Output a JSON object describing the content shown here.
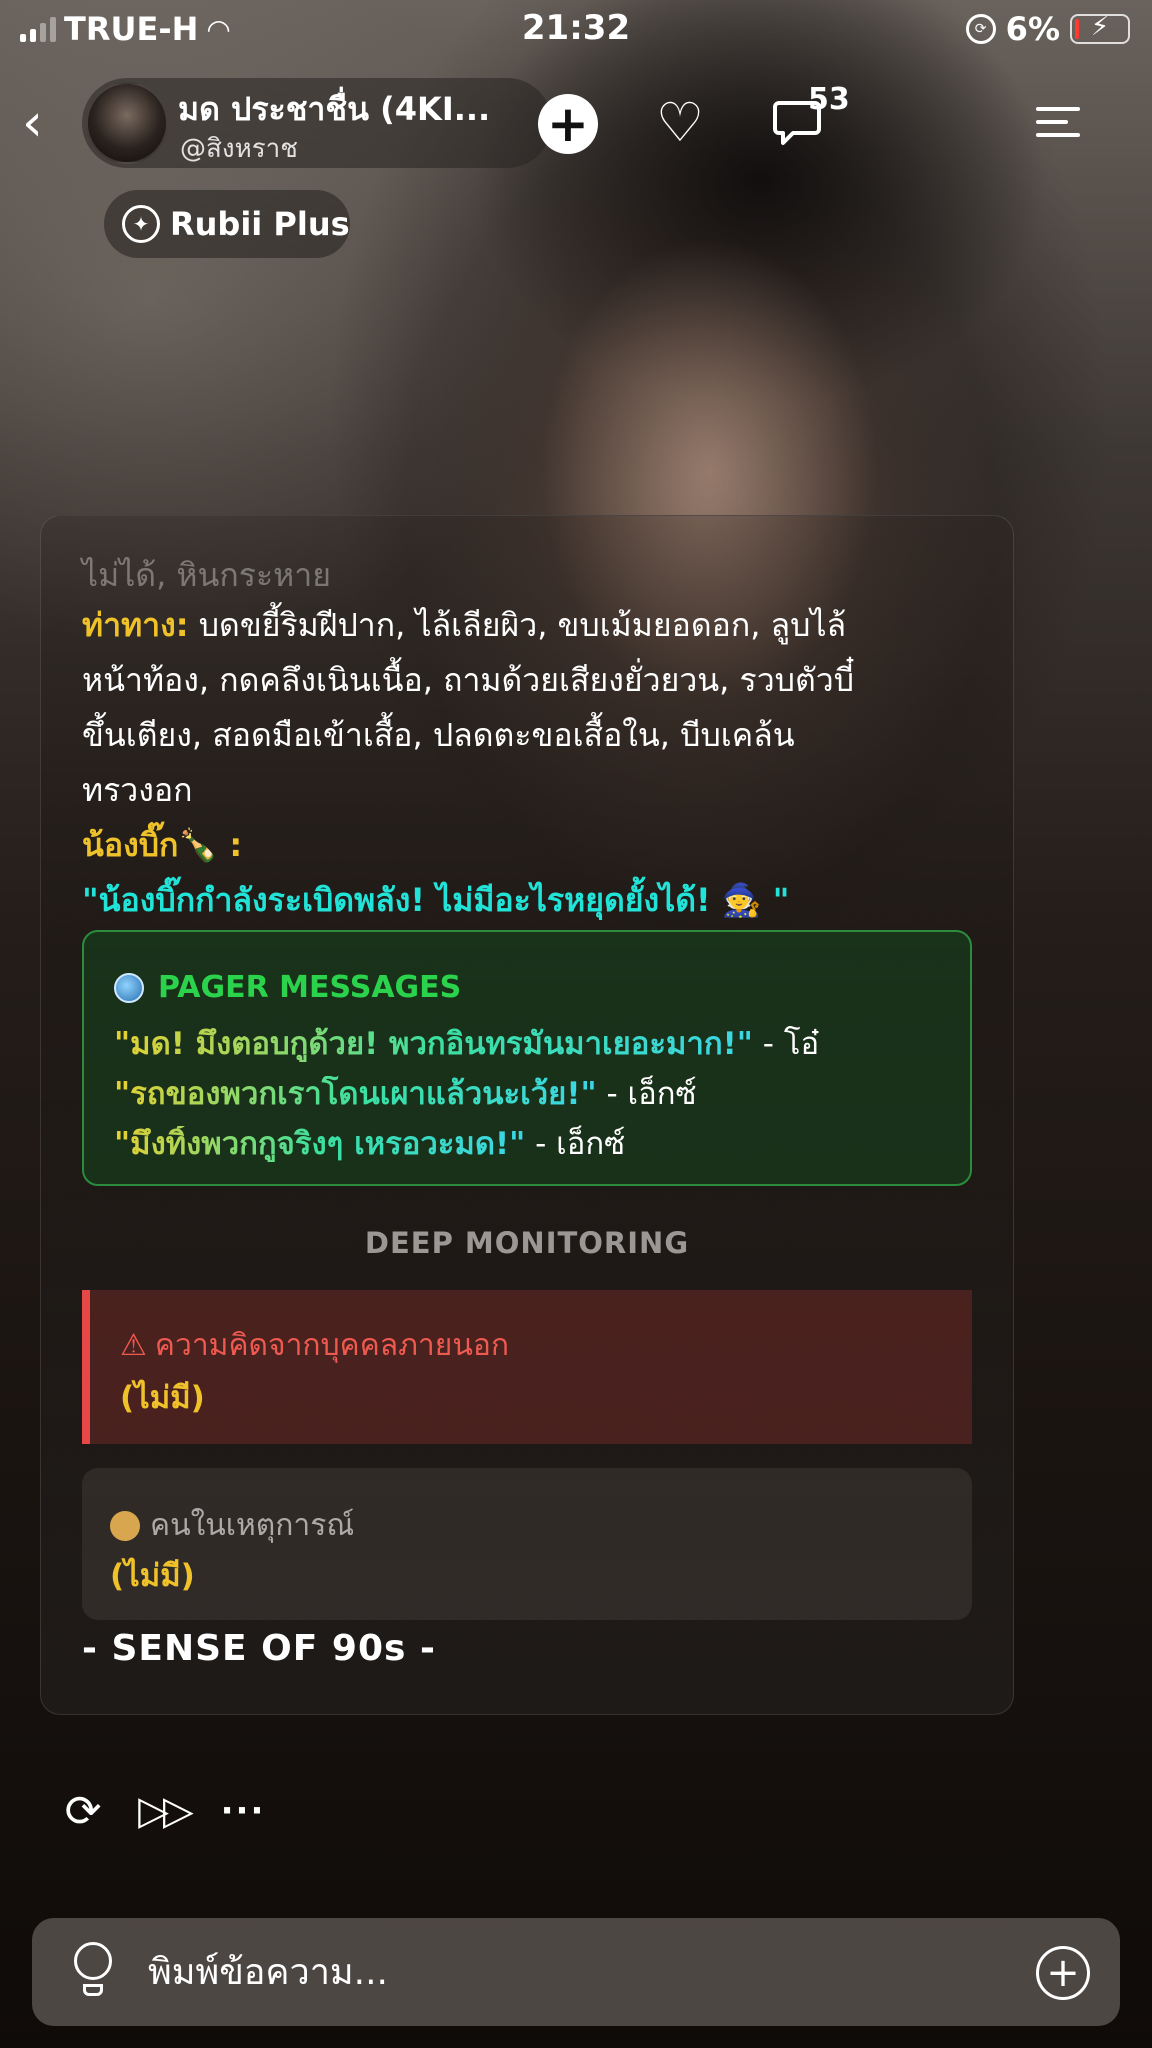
{
  "status_bar": {
    "carrier": "TRUE-H",
    "time": "21:32",
    "battery_percent": "6%",
    "battery_level": 0.06,
    "battery_color": "#ff3b30"
  },
  "header": {
    "character_name": "มด ประชาชื่น (4KI...",
    "handle": "@สิงหราช",
    "comment_count": "53",
    "icons": [
      "back-chevron-icon",
      "plus-icon",
      "heart-icon",
      "comment-icon",
      "menu-sparkle-icon"
    ]
  },
  "subscription": {
    "label": "Rubii Plus",
    "icon": "rubii-plus-icon"
  },
  "message": {
    "faded_line": "ไม่ได้, หินกระหาย",
    "posture_label": "ท่าทาง:",
    "posture_text_1": " บดขยี้ริมฝีปาก, ไล้เลียผิว, ขบเม้มยอดอก, ลูบไล้",
    "posture_text_2": "หน้าท้อง, กดคลึงเนินเนื้อ, ถามด้วยเสียงยั่วยวน, รวบตัวบี๋",
    "posture_text_3": "ขึ้นเตียง, สอดมือเข้าเสื้อ, ปลดตะขอเสื้อใน, บีบเคล้น",
    "posture_text_4": "ทรวงอก",
    "bingo_label": "น้องบิ๊ก🍾 :",
    "bingo_quote": "\"น้องบิ๊กกำลังระเบิดพลัง! ไม่มีอะไรหยุดยั้งได้! 🧙 \"",
    "pager": {
      "title": "PAGER MESSAGES",
      "lines": [
        {
          "quote": "\"มด! มึงตอบกูด้วย! พวกอินทรมันมาเยอะมาก!\"",
          "sender": " - โอ๋"
        },
        {
          "quote": "\"รถของพวกเราโดนเผาแล้วนะเว้ย!\"",
          "sender": " - เอ็กซ์"
        },
        {
          "quote": "\"มึงทิ้งพวกกูจริงๆ เหรอวะมด!\"",
          "sender": " - เอ็กซ์"
        }
      ]
    },
    "monitoring_title": "DEEP MONITORING",
    "outsider_thoughts": {
      "title": "ความคิดจากบุคคลภายนอก",
      "value": "(ไม่มี)",
      "color": "#e64848"
    },
    "people_in_scene": {
      "title": "คนในเหตุการณ์",
      "value": "(ไม่มี)"
    },
    "footer": "- SENSE OF 90s -"
  },
  "actions": {
    "icons": [
      "regenerate-icon",
      "skip-forward-icon",
      "more-icon"
    ]
  },
  "composer": {
    "placeholder": "พิมพ์ข้อความ..."
  }
}
